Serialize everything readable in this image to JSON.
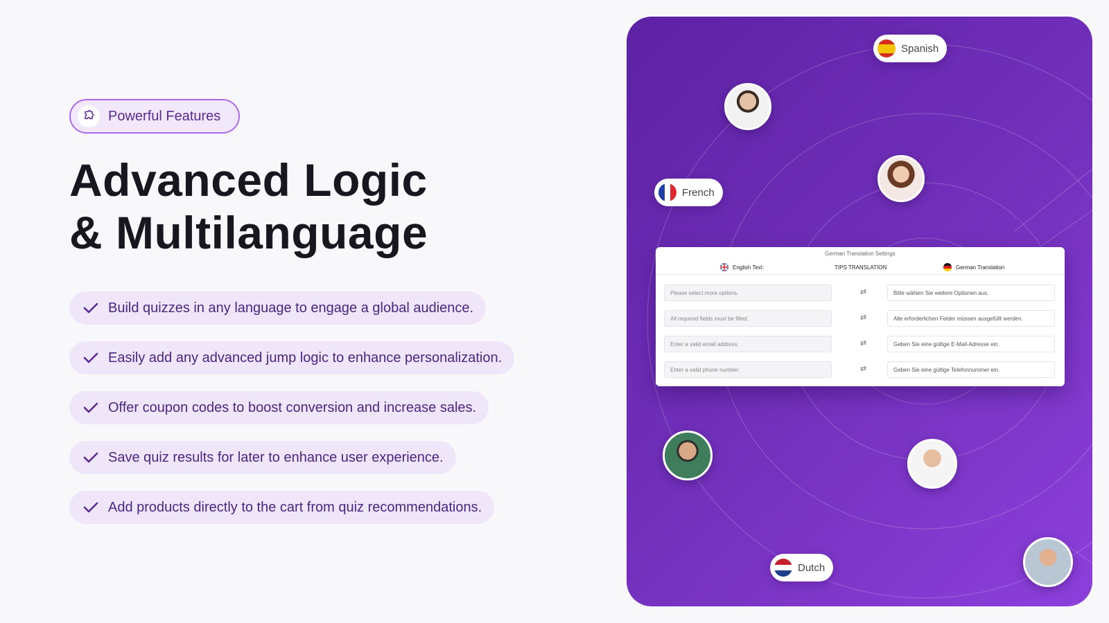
{
  "badge": {
    "label": "Powerful Features",
    "icon": "puzzle-icon"
  },
  "hero": {
    "title_line1": "Advanced Logic",
    "title_line2": "& Multilanguage"
  },
  "features": [
    "Build quizzes in any language to engage a global audience.",
    "Easily add any advanced jump logic to enhance  personalization.",
    "Offer coupon codes to boost conversion and increase sales.",
    "Save quiz results for later to enhance user experience.",
    "Add products directly to the cart from quiz recommendations."
  ],
  "languages": {
    "spanish": "Spanish",
    "french": "French",
    "dutch": "Dutch"
  },
  "colors": {
    "accent": "#7431bd",
    "feature_bg": "#efe6fa",
    "feature_text": "#4a2680"
  },
  "translation_card": {
    "title": "German Translation Settings",
    "col_source": "English Text:",
    "col_tips": "TIPS TRANSLATION",
    "col_target": "German Translation",
    "rows": [
      {
        "source": "Please select more options.",
        "target": "Bitte wählen Sie weitere Optionen aus."
      },
      {
        "source": "All required fields must be filled.",
        "target": "Alle erforderlichen Felder müssen ausgefüllt werden."
      },
      {
        "source": "Enter a valid email address.",
        "target": "Geben Sie eine gültige E-Mail-Adresse ein."
      },
      {
        "source": "Enter a valid phone number.",
        "target": "Geben Sie eine gültige Telefonnummer ein."
      }
    ]
  }
}
